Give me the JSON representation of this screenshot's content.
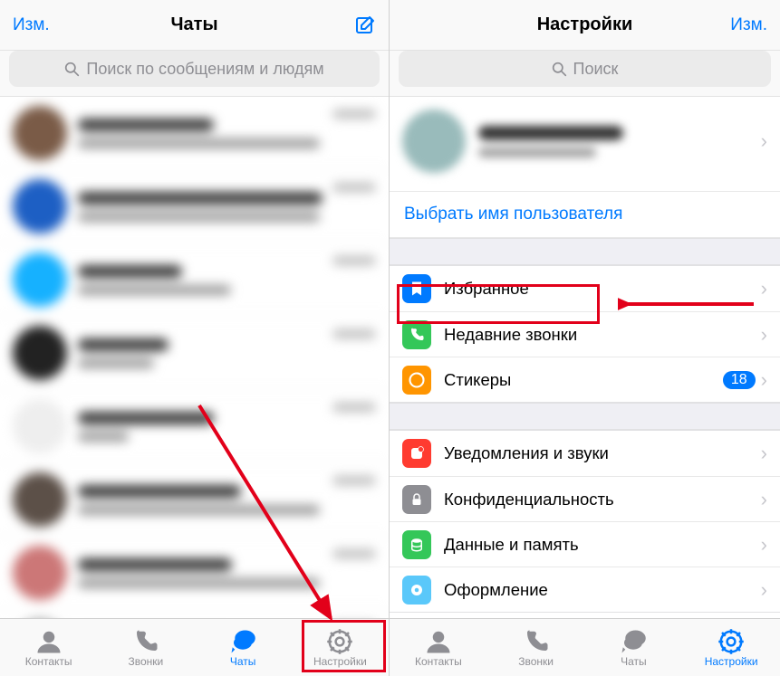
{
  "left": {
    "header": {
      "edit": "Изм.",
      "title": "Чаты"
    },
    "search": {
      "placeholder": "Поиск по сообщениям и людям"
    },
    "tabs": {
      "contacts": "Контакты",
      "calls": "Звонки",
      "chats": "Чаты",
      "settings": "Настройки"
    }
  },
  "right": {
    "header": {
      "edit": "Изм.",
      "title": "Настройки"
    },
    "search": {
      "placeholder": "Поиск"
    },
    "username_link": "Выбрать имя пользователя",
    "items": {
      "favorites": "Избранное",
      "recent_calls": "Недавние звонки",
      "stickers": "Стикеры",
      "stickers_badge": "18",
      "notifications": "Уведомления и звуки",
      "privacy": "Конфиденциальность",
      "data": "Данные и память",
      "appearance": "Оформление"
    },
    "tabs": {
      "contacts": "Контакты",
      "calls": "Звонки",
      "chats": "Чаты",
      "settings": "Настройки"
    }
  }
}
